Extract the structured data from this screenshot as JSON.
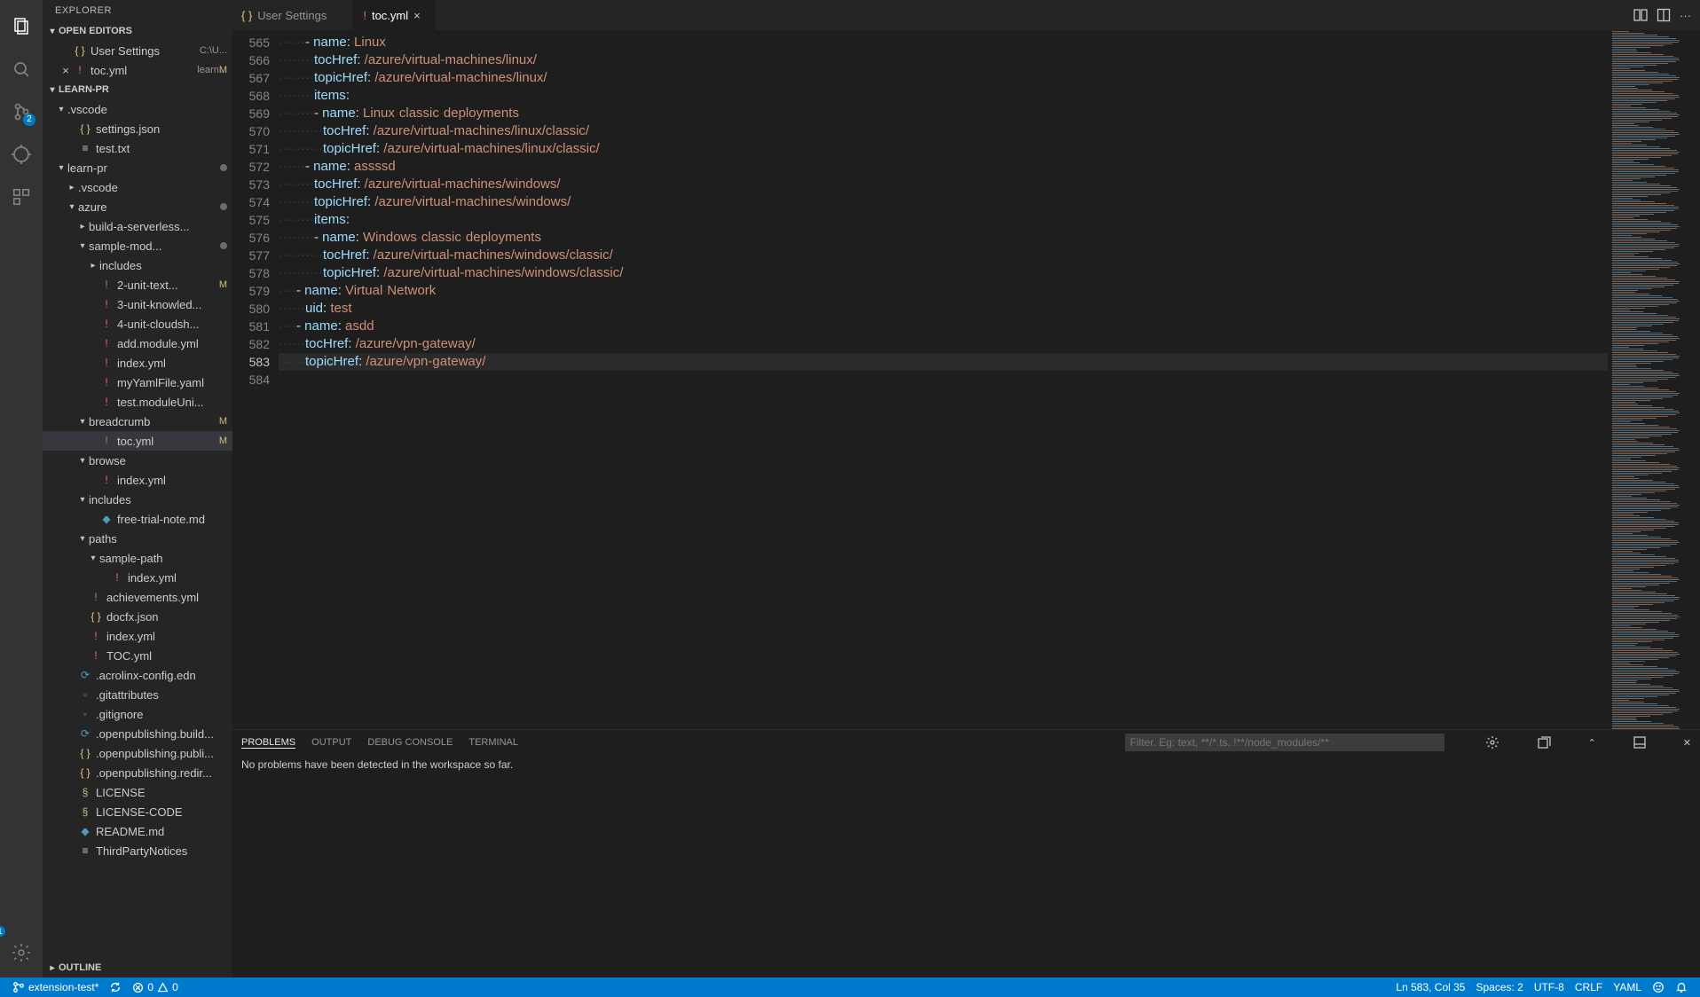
{
  "sidebar_title": "EXPLORER",
  "open_editors": {
    "header": "OPEN EDITORS",
    "items": [
      {
        "icon": "json",
        "name": "User Settings",
        "desc": "C:\\U..."
      },
      {
        "icon": "yaml",
        "name": "toc.yml",
        "desc": "learn...",
        "tag": "M",
        "active": true
      }
    ]
  },
  "workspace": {
    "header": "LEARN-PR",
    "tree": [
      {
        "d": 0,
        "type": "f",
        "open": true,
        "name": ".vscode"
      },
      {
        "d": 1,
        "type": "file",
        "icon": "json",
        "name": "settings.json"
      },
      {
        "d": 1,
        "type": "file",
        "icon": "file",
        "name": "test.txt"
      },
      {
        "d": 0,
        "type": "f",
        "open": true,
        "name": "learn-pr",
        "dot": true
      },
      {
        "d": 1,
        "type": "f",
        "open": false,
        "name": ".vscode"
      },
      {
        "d": 1,
        "type": "f",
        "open": true,
        "name": "azure",
        "dot": true
      },
      {
        "d": 2,
        "type": "f",
        "open": false,
        "name": "build-a-serverless..."
      },
      {
        "d": 2,
        "type": "f",
        "open": true,
        "name": "sample-mod...",
        "dot": true
      },
      {
        "d": 3,
        "type": "f",
        "open": false,
        "name": "includes"
      },
      {
        "d": 3,
        "type": "file",
        "icon": "yaml",
        "name": "2-unit-text...",
        "tag": "M"
      },
      {
        "d": 3,
        "type": "file",
        "icon": "yaml",
        "name": "3-unit-knowled..."
      },
      {
        "d": 3,
        "type": "file",
        "icon": "yaml",
        "name": "4-unit-cloudsh..."
      },
      {
        "d": 3,
        "type": "file",
        "icon": "yaml",
        "name": "add.module.yml"
      },
      {
        "d": 3,
        "type": "file",
        "icon": "yaml",
        "name": "index.yml"
      },
      {
        "d": 3,
        "type": "file",
        "icon": "yaml",
        "name": "myYamlFile.yaml"
      },
      {
        "d": 3,
        "type": "file",
        "icon": "yaml",
        "name": "test.moduleUni..."
      },
      {
        "d": 2,
        "type": "f",
        "open": true,
        "name": "breadcrumb",
        "tag": "M"
      },
      {
        "d": 3,
        "type": "file",
        "icon": "yaml",
        "name": "toc.yml",
        "tag": "M",
        "selected": true
      },
      {
        "d": 2,
        "type": "f",
        "open": true,
        "name": "browse"
      },
      {
        "d": 3,
        "type": "file",
        "icon": "yaml",
        "name": "index.yml"
      },
      {
        "d": 2,
        "type": "f",
        "open": true,
        "name": "includes"
      },
      {
        "d": 3,
        "type": "file",
        "icon": "md",
        "name": "free-trial-note.md"
      },
      {
        "d": 2,
        "type": "f",
        "open": true,
        "name": "paths"
      },
      {
        "d": 3,
        "type": "f",
        "open": true,
        "name": "sample-path"
      },
      {
        "d": 4,
        "type": "file",
        "icon": "yaml",
        "name": "index.yml"
      },
      {
        "d": 2,
        "type": "file",
        "icon": "yaml",
        "name": "achievements.yml"
      },
      {
        "d": 2,
        "type": "file",
        "icon": "json",
        "name": "docfx.json"
      },
      {
        "d": 2,
        "type": "file",
        "icon": "yaml",
        "name": "index.yml"
      },
      {
        "d": 2,
        "type": "file",
        "icon": "yaml",
        "name": "TOC.yml"
      },
      {
        "d": 1,
        "type": "file",
        "icon": "js",
        "name": ".acrolinx-config.edn"
      },
      {
        "d": 1,
        "type": "file",
        "icon": "git",
        "name": ".gitattributes"
      },
      {
        "d": 1,
        "type": "file",
        "icon": "git",
        "name": ".gitignore"
      },
      {
        "d": 1,
        "type": "file",
        "icon": "js",
        "name": ".openpublishing.build..."
      },
      {
        "d": 1,
        "type": "file",
        "icon": "json",
        "name": ".openpublishing.publi..."
      },
      {
        "d": 1,
        "type": "file",
        "icon": "json",
        "name": ".openpublishing.redir..."
      },
      {
        "d": 1,
        "type": "file",
        "icon": "lic",
        "name": "LICENSE"
      },
      {
        "d": 1,
        "type": "file",
        "icon": "lic",
        "name": "LICENSE-CODE"
      },
      {
        "d": 1,
        "type": "file",
        "icon": "md",
        "name": "README.md"
      },
      {
        "d": 1,
        "type": "file",
        "icon": "file",
        "name": "ThirdPartyNotices"
      }
    ]
  },
  "outline_header": "OUTLINE",
  "tabs": [
    {
      "icon": "json",
      "label": "User Settings",
      "active": false
    },
    {
      "icon": "yaml",
      "label": "toc.yml",
      "active": true
    }
  ],
  "code": {
    "start": 565,
    "current": 583,
    "lines": [
      [
        {
          "i": 6,
          "k": "dash",
          "t": "- "
        },
        {
          "k": "prop",
          "t": "name"
        },
        {
          "k": "colon",
          "t": ": "
        },
        {
          "k": "str",
          "t": "Linux"
        }
      ],
      [
        {
          "i": 8,
          "k": "prop",
          "t": "tocHref"
        },
        {
          "k": "colon",
          "t": ": "
        },
        {
          "k": "str",
          "t": "/azure/virtual-machines/linux/"
        }
      ],
      [
        {
          "i": 8,
          "k": "prop",
          "t": "topicHref"
        },
        {
          "k": "colon",
          "t": ": "
        },
        {
          "k": "str",
          "t": "/azure/virtual-machines/linux/"
        }
      ],
      [
        {
          "i": 8,
          "k": "prop",
          "t": "items"
        },
        {
          "k": "colon",
          "t": ":"
        }
      ],
      [
        {
          "i": 8,
          "k": "dash",
          "t": "- "
        },
        {
          "k": "prop",
          "t": "name"
        },
        {
          "k": "colon",
          "t": ": "
        },
        {
          "k": "str",
          "t": "Linux classic deployments"
        }
      ],
      [
        {
          "i": 10,
          "k": "prop",
          "t": "tocHref"
        },
        {
          "k": "colon",
          "t": ": "
        },
        {
          "k": "str",
          "t": "/azure/virtual-machines/linux/classic/"
        }
      ],
      [
        {
          "i": 10,
          "k": "prop",
          "t": "topicHref"
        },
        {
          "k": "colon",
          "t": ": "
        },
        {
          "k": "str",
          "t": "/azure/virtual-machines/linux/classic/"
        }
      ],
      [
        {
          "i": 6,
          "k": "dash",
          "t": "- "
        },
        {
          "k": "prop",
          "t": "name"
        },
        {
          "k": "colon",
          "t": ": "
        },
        {
          "k": "str",
          "t": "assssd"
        }
      ],
      [
        {
          "i": 8,
          "k": "prop",
          "t": "tocHref"
        },
        {
          "k": "colon",
          "t": ": "
        },
        {
          "k": "str",
          "t": "/azure/virtual-machines/windows/"
        }
      ],
      [
        {
          "i": 8,
          "k": "prop",
          "t": "topicHref"
        },
        {
          "k": "colon",
          "t": ": "
        },
        {
          "k": "str",
          "t": "/azure/virtual-machines/windows/"
        }
      ],
      [
        {
          "i": 8,
          "k": "prop",
          "t": "items"
        },
        {
          "k": "colon",
          "t": ":"
        }
      ],
      [
        {
          "i": 8,
          "k": "dash",
          "t": "- "
        },
        {
          "k": "prop",
          "t": "name"
        },
        {
          "k": "colon",
          "t": ": "
        },
        {
          "k": "str",
          "t": "Windows classic deployments"
        }
      ],
      [
        {
          "i": 10,
          "k": "prop",
          "t": "tocHref"
        },
        {
          "k": "colon",
          "t": ": "
        },
        {
          "k": "str",
          "t": "/azure/virtual-machines/windows/classic/"
        }
      ],
      [
        {
          "i": 10,
          "k": "prop",
          "t": "topicHref"
        },
        {
          "k": "colon",
          "t": ": "
        },
        {
          "k": "str",
          "t": "/azure/virtual-machines/windows/classic/"
        }
      ],
      [
        {
          "i": 4,
          "k": "dash",
          "t": "- "
        },
        {
          "k": "prop",
          "t": "name"
        },
        {
          "k": "colon",
          "t": ": "
        },
        {
          "k": "str",
          "t": "Virtual Network"
        }
      ],
      [
        {
          "i": 6,
          "k": "prop",
          "t": "uid"
        },
        {
          "k": "colon",
          "t": ": "
        },
        {
          "k": "str",
          "t": "test"
        }
      ],
      [
        {
          "i": 4,
          "k": "dash",
          "t": "- "
        },
        {
          "k": "prop",
          "t": "name"
        },
        {
          "k": "colon",
          "t": ": "
        },
        {
          "k": "str",
          "t": "asdd"
        }
      ],
      [
        {
          "i": 6,
          "k": "prop",
          "t": "tocHref"
        },
        {
          "k": "colon",
          "t": ": "
        },
        {
          "k": "str",
          "t": "/azure/vpn-gateway/"
        }
      ],
      [
        {
          "i": 6,
          "k": "prop",
          "t": "topicHref"
        },
        {
          "k": "colon",
          "t": ": "
        },
        {
          "k": "str",
          "t": "/azure/vpn-gateway/"
        }
      ],
      []
    ]
  },
  "panel": {
    "tabs": [
      "PROBLEMS",
      "OUTPUT",
      "DEBUG CONSOLE",
      "TERMINAL"
    ],
    "active": 0,
    "filter_placeholder": "Filter. Eg: text, **/*.ts, !**/node_modules/**",
    "message": "No problems have been detected in the workspace so far."
  },
  "status": {
    "branch": "extension-test*",
    "sync": "",
    "errors": "0",
    "warnings": "0",
    "pos": "Ln 583, Col 35",
    "spaces": "Spaces: 2",
    "enc": "UTF-8",
    "eol": "CRLF",
    "lang": "YAML"
  },
  "scm_badge": "2",
  "gear_badge": "1"
}
